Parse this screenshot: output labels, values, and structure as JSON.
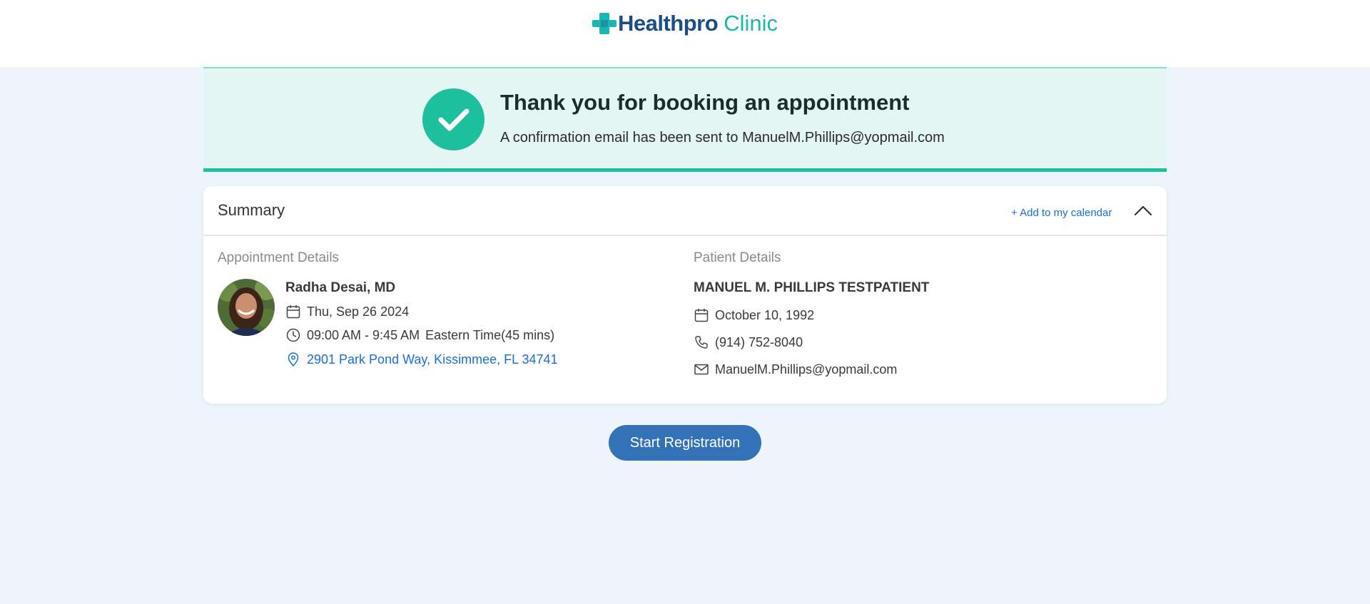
{
  "brand": {
    "health": "Health",
    "pro": "pro",
    "clinic": "Clinic",
    "colors": {
      "primary": "#1a4e8a",
      "accent": "#19b7b0"
    }
  },
  "confirmation": {
    "title": "Thank you for booking an appointment",
    "message": "A confirmation email has been sent to ManuelM.Phillips@yopmail.com",
    "icon": "check-icon",
    "color": "#1dbf9c"
  },
  "summary": {
    "title": "Summary",
    "add_calendar_label": "+ Add to my calendar",
    "collapse_icon": "chevron-up-icon"
  },
  "appointment": {
    "section_label": "Appointment Details",
    "doctor_name": "Radha Desai, MD",
    "date": "Thu, Sep 26 2024",
    "time": "09:00 AM - 9:45 AM",
    "timezone": "Eastern Time(45 mins)",
    "address": "2901 Park Pond Way, Kissimmee, FL 34741"
  },
  "patient": {
    "section_label": "Patient Details",
    "name": "MANUEL M. PHILLIPS TESTPATIENT",
    "dob": "October 10, 1992",
    "phone": "(914) 752-8040",
    "email": "ManuelM.Phillips@yopmail.com"
  },
  "actions": {
    "start_registration_label": "Start Registration"
  }
}
